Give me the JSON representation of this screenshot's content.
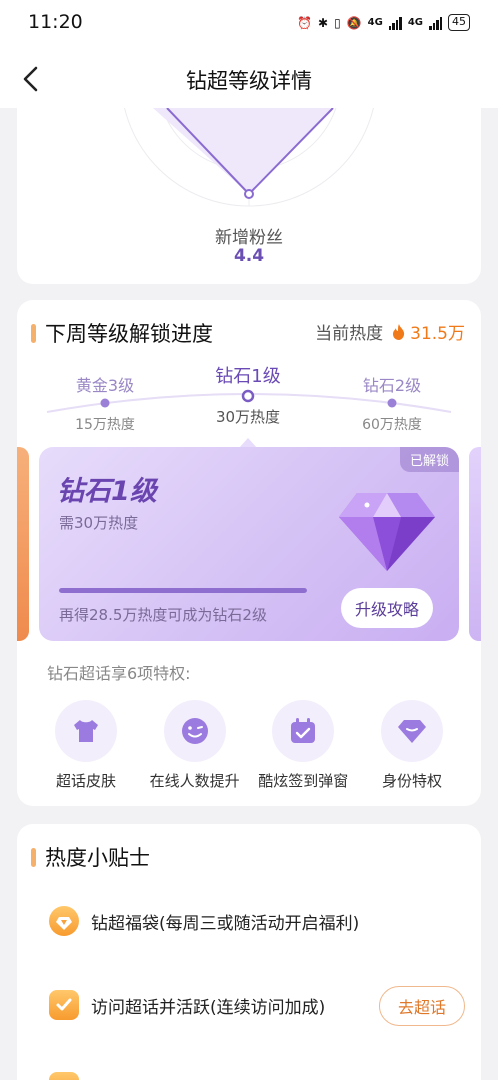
{
  "status": {
    "time": "11:20",
    "net1": "4G",
    "net2": "4G",
    "battery": "45"
  },
  "nav": {
    "title": "钻超等级详情"
  },
  "radar": {
    "axis_label": "新增粉丝",
    "axis_value": "4.4"
  },
  "progress": {
    "section_title": "下周等级解锁进度",
    "current_heat_label": "当前热度",
    "current_heat_value": "31.5万",
    "levels": [
      {
        "name": "黄金3级",
        "heat": "15万热度"
      },
      {
        "name": "钻石1级",
        "heat": "30万热度"
      },
      {
        "name": "钻石2级",
        "heat": "60万热度"
      }
    ],
    "card": {
      "tag": "已解锁",
      "level_name": "钻石1级",
      "requirement": "需30万热度",
      "progress_fraction": 1.0,
      "tip": "再得28.5万热度可成为钻石2级",
      "upgrade_button": "升级攻略"
    },
    "privileges_title": "钻石超话享6项特权:",
    "privileges": [
      {
        "label": "超话皮肤",
        "icon": "shirt-icon"
      },
      {
        "label": "在线人数提升",
        "icon": "wink-face-icon"
      },
      {
        "label": "酷炫签到弹窗",
        "icon": "calendar-check-icon"
      },
      {
        "label": "身份特权",
        "icon": "diamond-icon"
      }
    ]
  },
  "tips": {
    "section_title": "热度小贴士",
    "items": [
      {
        "text": "钻超福袋(每周三或随活动开启福利)",
        "icon": "lucky-bag-icon",
        "button": ""
      },
      {
        "text": "访问超话并活跃(连续访问加成)",
        "icon": "checkmark-icon",
        "button": "去超话"
      }
    ]
  },
  "colors": {
    "accent_purple": "#6a45b0",
    "heat_orange": "#f07a1a",
    "section_bar": "#f5b06c"
  }
}
